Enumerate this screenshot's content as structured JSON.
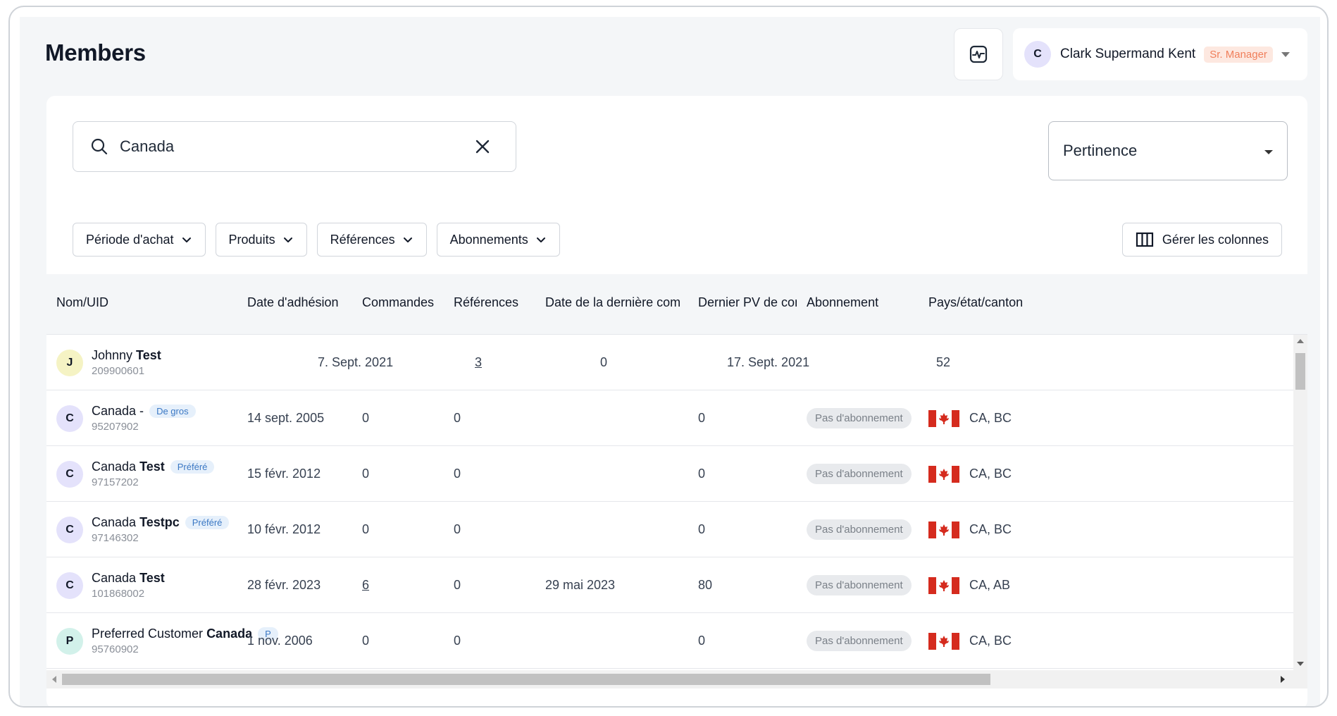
{
  "header": {
    "title": "Members",
    "activity_icon": "activity-monitor-icon",
    "user": {
      "initial": "C",
      "name": "Clark Supermand Kent",
      "role": "Sr. Manager"
    }
  },
  "search": {
    "value": "Canada",
    "icon": "search-icon"
  },
  "sort": {
    "value": "Pertinence"
  },
  "filters": [
    {
      "label": "Période d'achat"
    },
    {
      "label": "Produits"
    },
    {
      "label": "Références"
    },
    {
      "label": "Abonnements"
    }
  ],
  "columns_button": {
    "label": "Gérer les colonnes"
  },
  "table": {
    "columns": [
      "Nom/UID",
      "Date d'adhésion",
      "Commandes",
      "Références",
      "Date de la dernière commar",
      "Dernier PV de com",
      "Abonnement",
      "Pays/état/canton"
    ],
    "rows": [
      {
        "initial": "J",
        "avatar": "yellow",
        "first": "Johnny",
        "last": "Test",
        "tier": "",
        "uid": "209900601",
        "joined": "",
        "orders": "7. Sept. 2021",
        "refs": "3",
        "last_order": "0",
        "last_pv": "17. Sept. 2021",
        "subscription": "",
        "country": "52"
      },
      {
        "initial": "C",
        "avatar": "purple",
        "first": "Canada -",
        "last": "",
        "tier": "De gros",
        "uid": "95207902",
        "joined": "14 sept. 2005",
        "orders": "0",
        "refs": "0",
        "last_order": "",
        "last_pv": "0",
        "subscription": "Pas d'abonnement",
        "country": "CA, BC"
      },
      {
        "initial": "C",
        "avatar": "purple",
        "first": "Canada",
        "last": "Test",
        "tier": "Préféré",
        "uid": "97157202",
        "joined": "15 févr. 2012",
        "orders": "0",
        "refs": "0",
        "last_order": "",
        "last_pv": "0",
        "subscription": "Pas d'abonnement",
        "country": "CA, BC"
      },
      {
        "initial": "C",
        "avatar": "purple",
        "first": "Canada",
        "last": "Testpc",
        "tier": "Préféré",
        "uid": "97146302",
        "joined": "10 févr. 2012",
        "orders": "0",
        "refs": "0",
        "last_order": "",
        "last_pv": "0",
        "subscription": "Pas d'abonnement",
        "country": "CA, BC"
      },
      {
        "initial": "C",
        "avatar": "purple",
        "first": "Canada",
        "last": "Test",
        "tier": "",
        "uid": "101868002",
        "joined": "28 févr. 2023",
        "orders": "6",
        "refs": "0",
        "last_order": "29 mai 2023",
        "last_pv": "80",
        "subscription": "Pas d'abonnement",
        "country": "CA, AB"
      },
      {
        "initial": "P",
        "avatar": "teal",
        "first": "Preferred Customer",
        "last": "Canada",
        "tier": "P",
        "uid": "95760902",
        "joined": "1 nov. 2006",
        "orders": "0",
        "refs": "0",
        "last_order": "",
        "last_pv": "0",
        "subscription": "Pas d'abonnement",
        "country": "CA, BC"
      }
    ]
  },
  "colors": {
    "accent_role": "#f07f5b",
    "tier_badge": "#3b78c4",
    "flag_red": "#d52b1e"
  }
}
